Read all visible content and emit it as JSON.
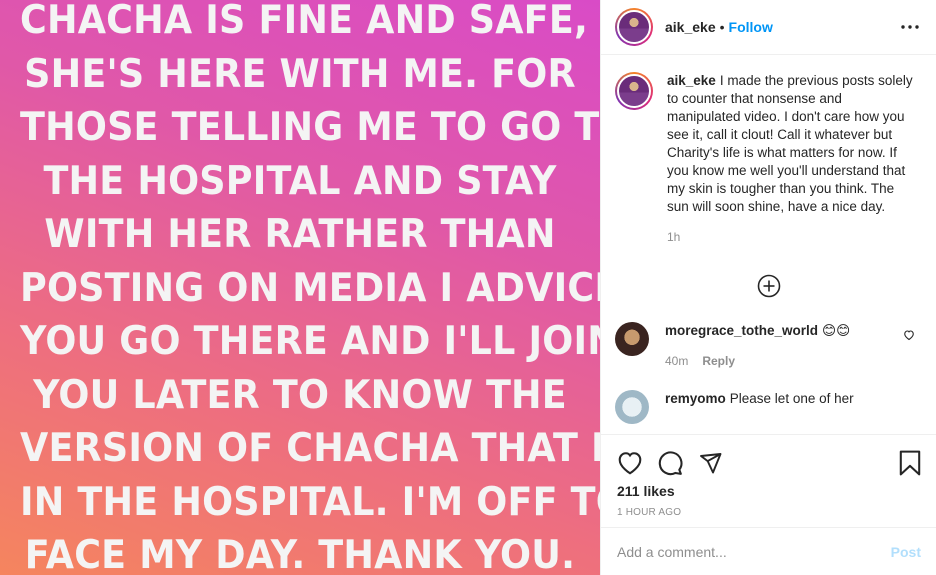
{
  "image_text_lines": [
    "CHACHA IS FINE AND SAFE,",
    "SHE'S HERE WITH ME. FOR",
    "THOSE TELLING ME TO GO TO",
    "THE HOSPITAL AND STAY",
    "WITH HER RATHER THAN",
    "POSTING ON MEDIA I ADVICE",
    "YOU GO THERE AND I'LL JOIN",
    "YOU LATER TO KNOW THE",
    "VERSION OF CHACHA THAT IS",
    "IN THE HOSPITAL. I'M OFF TO",
    "FACE MY DAY. THANK YOU."
  ],
  "header": {
    "username": "aik_eke",
    "dot": "•",
    "follow_label": "Follow"
  },
  "caption": {
    "username": "aik_eke",
    "text": "I made the previous posts solely to counter that nonsense and manipulated video. I don't care how you see it, call it clout! Call it whatever but Charity's life is what matters for now. If you know me well you'll understand that my skin is tougher than you think. The sun will soon shine, have a nice day.",
    "time": "1h"
  },
  "comments": [
    {
      "username": "moregrace_tothe_world",
      "text": "😊😊",
      "time": "40m",
      "reply_label": "Reply"
    },
    {
      "username": "remyomo",
      "text": "Please let one of her",
      "time": "",
      "reply_label": ""
    }
  ],
  "likes": "211 likes",
  "timestamp": "1 HOUR AGO",
  "add_comment": {
    "placeholder": "Add a comment...",
    "post_label": "Post"
  },
  "colors": {
    "link": "#0095f6",
    "post_disabled": "#b2dffc",
    "muted": "#8e8e8e"
  }
}
